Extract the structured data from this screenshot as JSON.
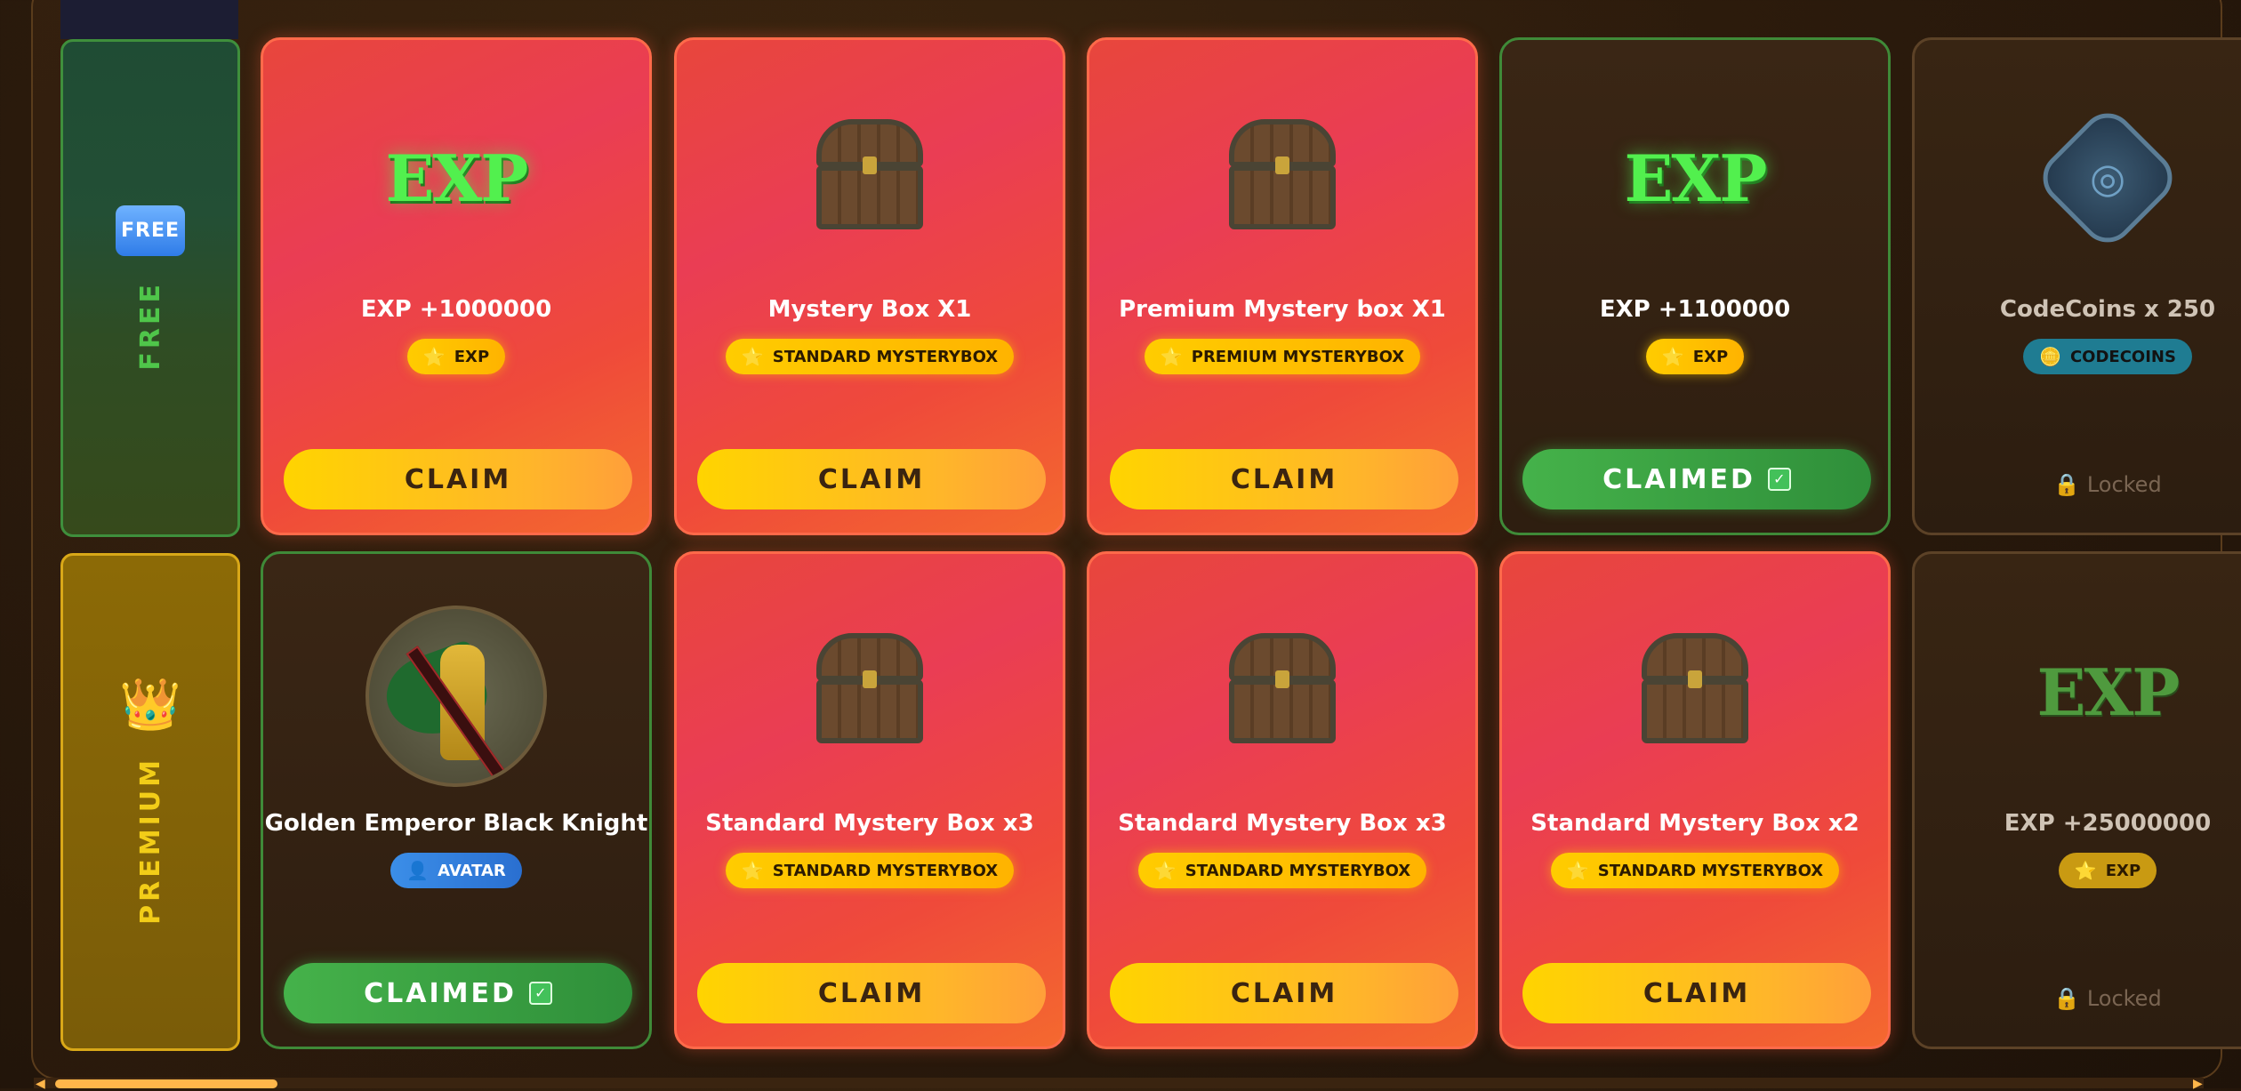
{
  "lanes": {
    "free": {
      "badge": "FREE",
      "label": "FREE"
    },
    "premium": {
      "icon": "crown-icon",
      "label": "PREMIUM"
    }
  },
  "free_row": [
    {
      "style": "red",
      "visual": "EXP",
      "title": "EXP +1000000",
      "tag": "EXP",
      "tag_icon": "star-icon",
      "action": "CLAIM"
    },
    {
      "style": "red",
      "visual": "chest",
      "title": "Mystery Box X1",
      "tag": "STANDARD MYSTERYBOX",
      "tag_icon": "star-icon",
      "action": "CLAIM"
    },
    {
      "style": "red",
      "visual": "chest",
      "title": "Premium Mystery box X1",
      "tag": "PREMIUM MYSTERYBOX",
      "tag_icon": "star-icon",
      "action": "CLAIM"
    },
    {
      "style": "green",
      "visual": "EXP",
      "title": "EXP +1100000",
      "tag": "EXP",
      "tag_icon": "star-icon",
      "action": "CLAIMED"
    },
    {
      "style": "locked",
      "visual": "codecoins-emblem",
      "title": "CodeCoins x 250",
      "tag": "CODECOINS",
      "tag_icon": "coin-icon",
      "action": "Locked"
    }
  ],
  "premium_row": [
    {
      "style": "green",
      "visual": "avatar",
      "title": "Golden Emperor Black Knight",
      "tag": "AVATAR",
      "tag_icon": "user-icon",
      "action": "CLAIMED"
    },
    {
      "style": "red",
      "visual": "chest",
      "title": "Standard Mystery Box x3",
      "tag": "STANDARD MYSTERYBOX",
      "tag_icon": "star-icon",
      "action": "CLAIM"
    },
    {
      "style": "red",
      "visual": "chest",
      "title": "Standard Mystery Box x3",
      "tag": "STANDARD MYSTERYBOX",
      "tag_icon": "star-icon",
      "action": "CLAIM"
    },
    {
      "style": "red",
      "visual": "chest",
      "title": "Standard Mystery Box x2",
      "tag": "STANDARD MYSTERYBOX",
      "tag_icon": "star-icon",
      "action": "CLAIM"
    },
    {
      "style": "locked",
      "visual": "EXP",
      "title": "EXP +25000000",
      "tag": "EXP",
      "tag_icon": "star-icon",
      "action": "Locked"
    }
  ],
  "colors": {
    "claim": "#ffc21a",
    "claimed": "#3ea844",
    "card_red": "#ea3d54",
    "free_lane": "#3f8f3c",
    "premium_lane": "#d9a818"
  },
  "scroll": {
    "position": 0.1
  }
}
